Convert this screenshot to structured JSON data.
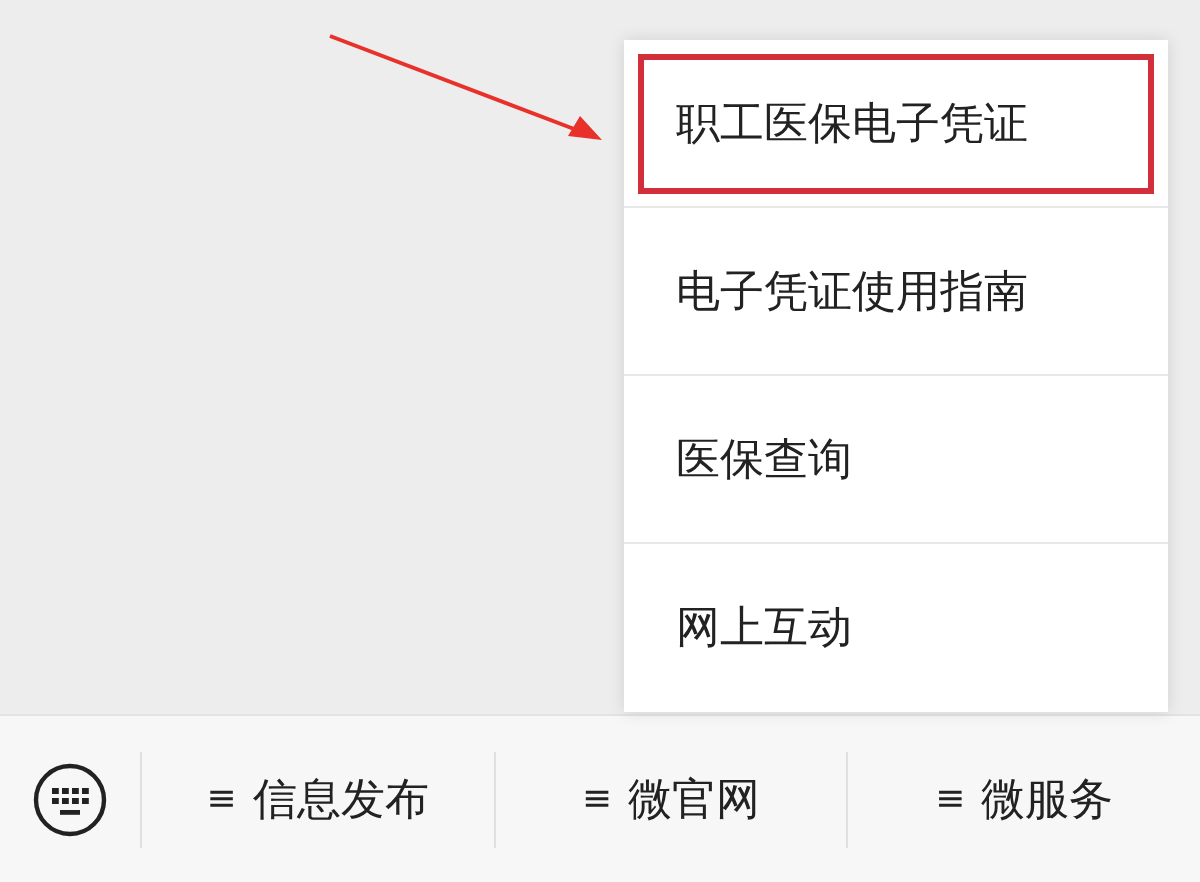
{
  "popup_menu": {
    "items": [
      {
        "label": "职工医保电子凭证",
        "highlighted": true
      },
      {
        "label": "电子凭证使用指南",
        "highlighted": false
      },
      {
        "label": "医保查询",
        "highlighted": false
      },
      {
        "label": "网上互动",
        "highlighted": false
      }
    ]
  },
  "bottom_bar": {
    "menus": [
      {
        "glyph": "≡",
        "label": "信息发布"
      },
      {
        "glyph": "≡",
        "label": "微官网"
      },
      {
        "glyph": "≡",
        "label": "微服务"
      }
    ]
  }
}
